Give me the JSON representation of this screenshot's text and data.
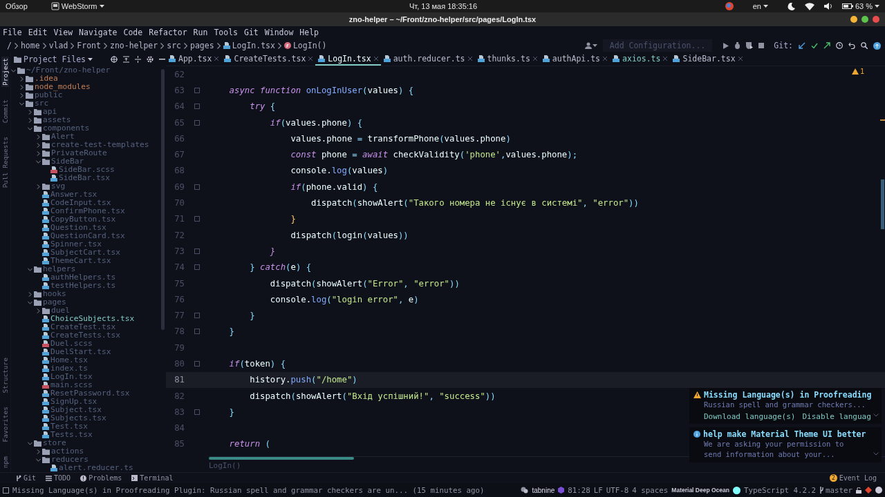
{
  "os_bar": {
    "activities": "Обзор",
    "app": "WebStorm",
    "clock": "Чт, 13 мая  18:35:16",
    "language": "en",
    "battery": "63 %"
  },
  "window": {
    "title": "zno-helper – ~/Front/zno-helper/src/pages/LogIn.tsx"
  },
  "menu": [
    "File",
    "Edit",
    "View",
    "Navigate",
    "Code",
    "Refactor",
    "Run",
    "Tools",
    "Git",
    "Window",
    "Help"
  ],
  "breadcrumbs": [
    {
      "label": "/",
      "kind": "dir"
    },
    {
      "label": "home",
      "kind": "dir"
    },
    {
      "label": "vlad",
      "kind": "dir"
    },
    {
      "label": "Front",
      "kind": "dir"
    },
    {
      "label": "zno-helper",
      "kind": "dir"
    },
    {
      "label": "src",
      "kind": "dir"
    },
    {
      "label": "pages",
      "kind": "dir"
    },
    {
      "label": "LogIn.tsx",
      "kind": "file"
    },
    {
      "label": "LogIn()",
      "kind": "function"
    }
  ],
  "toolbar": {
    "run_configuration": "Add Configuration...",
    "git_label": "Git:"
  },
  "left_strip": {
    "top": [
      {
        "label": "Project",
        "selected": true
      },
      {
        "label": "Commit",
        "selected": false
      },
      {
        "label": "Pull Requests",
        "selected": false
      }
    ],
    "bottom": [
      {
        "label": "Structure",
        "selected": false
      },
      {
        "label": "Favorites",
        "selected": false
      },
      {
        "label": "npm",
        "selected": false
      }
    ]
  },
  "project_panel": {
    "title": "Project Files"
  },
  "tabs": [
    {
      "label": "App.tsx",
      "selected": false,
      "color": "#b7bbcc"
    },
    {
      "label": "CreateTests.tsx",
      "selected": false,
      "color": "#b7bbcc"
    },
    {
      "label": "LogIn.tsx",
      "selected": true,
      "color": "#eeffff"
    },
    {
      "label": "auth.reducer.ts",
      "selected": false,
      "color": "#b7bbcc"
    },
    {
      "label": "thunks.ts",
      "selected": false,
      "color": "#b7bbcc"
    },
    {
      "label": "authApi.ts",
      "selected": false,
      "color": "#b7bbcc"
    },
    {
      "label": "axios.ts",
      "selected": false,
      "color": "#80cbc4"
    },
    {
      "label": "SideBar.tsx",
      "selected": false,
      "color": "#b7bbcc"
    }
  ],
  "tree": [
    {
      "label": "~/Front/zno-helper",
      "kind": "folder",
      "expanded": true,
      "color": "#56627f",
      "children": [
        {
          "label": ".idea",
          "kind": "folder",
          "expanded": false,
          "color": "#c17e55"
        },
        {
          "label": "node_modules",
          "kind": "folder",
          "expanded": false,
          "color": "#c17e55"
        },
        {
          "label": "public",
          "kind": "folder",
          "expanded": false,
          "color": "#56627f"
        },
        {
          "label": "src",
          "kind": "folder",
          "expanded": true,
          "color": "#56627f",
          "children": [
            {
              "label": "api",
              "kind": "folder",
              "expanded": false,
              "color": "#56627f"
            },
            {
              "label": "assets",
              "kind": "folder",
              "expanded": false,
              "color": "#56627f"
            },
            {
              "label": "components",
              "kind": "folder",
              "expanded": true,
              "color": "#56627f",
              "children": [
                {
                  "label": "Alert",
                  "kind": "folder",
                  "expanded": false,
                  "color": "#56627f"
                },
                {
                  "label": "create-test-templates",
                  "kind": "folder",
                  "expanded": false,
                  "color": "#56627f"
                },
                {
                  "label": "PrivateRoute",
                  "kind": "folder",
                  "expanded": false,
                  "color": "#56627f"
                },
                {
                  "label": "SideBar",
                  "kind": "folder",
                  "expanded": true,
                  "color": "#56627f",
                  "children": [
                    {
                      "label": "SideBar.scss",
                      "kind": "style",
                      "color": "#56627f"
                    },
                    {
                      "label": "SideBar.tsx",
                      "kind": "script",
                      "color": "#56627f"
                    }
                  ]
                },
                {
                  "label": "svg",
                  "kind": "folder",
                  "expanded": false,
                  "color": "#56627f"
                },
                {
                  "label": "Answer.tsx",
                  "kind": "script",
                  "color": "#56627f"
                },
                {
                  "label": "CodeInput.tsx",
                  "kind": "script",
                  "color": "#56627f"
                },
                {
                  "label": "ConfirmPhone.tsx",
                  "kind": "script",
                  "color": "#56627f"
                },
                {
                  "label": "CopyButton.tsx",
                  "kind": "script",
                  "color": "#56627f"
                },
                {
                  "label": "Question.tsx",
                  "kind": "script",
                  "color": "#56627f"
                },
                {
                  "label": "QuestionCard.tsx",
                  "kind": "script",
                  "color": "#56627f"
                },
                {
                  "label": "Spinner.tsx",
                  "kind": "script",
                  "color": "#56627f"
                },
                {
                  "label": "SubjectCart.tsx",
                  "kind": "script",
                  "color": "#56627f"
                },
                {
                  "label": "ThemeCart.tsx",
                  "kind": "script",
                  "color": "#56627f"
                }
              ]
            },
            {
              "label": "helpers",
              "kind": "folder",
              "expanded": true,
              "color": "#56627f",
              "children": [
                {
                  "label": "authHelpers.ts",
                  "kind": "script",
                  "color": "#56627f"
                },
                {
                  "label": "testHelpers.ts",
                  "kind": "script",
                  "color": "#56627f"
                }
              ]
            },
            {
              "label": "hooks",
              "kind": "folder",
              "expanded": false,
              "color": "#56627f"
            },
            {
              "label": "pages",
              "kind": "folder",
              "expanded": true,
              "color": "#56627f",
              "children": [
                {
                  "label": "duel",
                  "kind": "folder",
                  "expanded": false,
                  "color": "#56627f"
                },
                {
                  "label": "ChoiceSubjects.tsx",
                  "kind": "script",
                  "color": "#80cbc4"
                },
                {
                  "label": "CreateTest.tsx",
                  "kind": "script",
                  "color": "#56627f"
                },
                {
                  "label": "CreateTests.tsx",
                  "kind": "script",
                  "color": "#56627f"
                },
                {
                  "label": "Duel.scss",
                  "kind": "style",
                  "color": "#56627f"
                },
                {
                  "label": "DuelStart.tsx",
                  "kind": "script",
                  "color": "#56627f"
                },
                {
                  "label": "Home.tsx",
                  "kind": "script",
                  "color": "#56627f"
                },
                {
                  "label": "index.ts",
                  "kind": "script",
                  "color": "#56627f"
                },
                {
                  "label": "LogIn.tsx",
                  "kind": "script",
                  "color": "#56627f"
                },
                {
                  "label": "main.scss",
                  "kind": "style",
                  "color": "#56627f"
                },
                {
                  "label": "ResetPassword.tsx",
                  "kind": "script",
                  "color": "#56627f"
                },
                {
                  "label": "SignUp.tsx",
                  "kind": "script",
                  "color": "#56627f"
                },
                {
                  "label": "Subject.tsx",
                  "kind": "script",
                  "color": "#56627f"
                },
                {
                  "label": "Subjects.tsx",
                  "kind": "script",
                  "color": "#56627f"
                },
                {
                  "label": "Test.tsx",
                  "kind": "script",
                  "color": "#56627f"
                },
                {
                  "label": "Tests.tsx",
                  "kind": "script",
                  "color": "#56627f"
                }
              ]
            },
            {
              "label": "store",
              "kind": "folder",
              "expanded": true,
              "color": "#56627f",
              "children": [
                {
                  "label": "actions",
                  "kind": "folder",
                  "expanded": false,
                  "color": "#56627f"
                },
                {
                  "label": "reducers",
                  "kind": "folder",
                  "expanded": true,
                  "color": "#56627f",
                  "children": [
                    {
                      "label": "alert.reducer.ts",
                      "kind": "script",
                      "color": "#56627f"
                    }
                  ]
                }
              ]
            }
          ]
        }
      ]
    }
  ],
  "editor": {
    "problems": "1",
    "breadcrumb": "LogIn()",
    "lines": [
      {
        "num": "62",
        "fold": false,
        "current": false
      },
      {
        "num": "63",
        "fold": true,
        "current": false,
        "tokens": [
          {
            "text": "    async function ",
            "kind": "kw"
          },
          {
            "text": "onLogInUser",
            "kind": "fn"
          },
          {
            "text": "(",
            "kind": "p"
          },
          {
            "text": "values",
            "kind": "v"
          },
          {
            "text": ") {",
            "kind": "p"
          }
        ]
      },
      {
        "num": "64",
        "fold": true,
        "current": false,
        "tokens": [
          {
            "text": "        try",
            "kind": "kw"
          },
          {
            "text": " {",
            "kind": "p"
          }
        ]
      },
      {
        "num": "65",
        "fold": true,
        "current": false,
        "tokens": [
          {
            "text": "            if",
            "kind": "kw"
          },
          {
            "text": "(",
            "kind": "p"
          },
          {
            "text": "values.phone",
            "kind": "v"
          },
          {
            "text": ") {",
            "kind": "p"
          }
        ]
      },
      {
        "num": "66",
        "fold": false,
        "current": false,
        "tokens": [
          {
            "text": "                values.phone ",
            "kind": "v"
          },
          {
            "text": "= ",
            "kind": "p"
          },
          {
            "text": "transformPhone",
            "kind": "v"
          },
          {
            "text": "(",
            "kind": "p"
          },
          {
            "text": "values.phone",
            "kind": "v"
          },
          {
            "text": ")",
            "kind": "p"
          }
        ]
      },
      {
        "num": "67",
        "fold": false,
        "current": false,
        "tokens": [
          {
            "text": "                const ",
            "kind": "kw"
          },
          {
            "text": "phone ",
            "kind": "v"
          },
          {
            "text": "= ",
            "kind": "p"
          },
          {
            "text": "await ",
            "kind": "kw"
          },
          {
            "text": "checkValidity",
            "kind": "v"
          },
          {
            "text": "(",
            "kind": "p"
          },
          {
            "text": "'phone'",
            "kind": "s"
          },
          {
            "text": ",",
            "kind": "p"
          },
          {
            "text": "values.phone",
            "kind": "v"
          },
          {
            "text": ");",
            "kind": "p"
          }
        ]
      },
      {
        "num": "68",
        "fold": false,
        "current": false,
        "tokens": [
          {
            "text": "                console.",
            "kind": "v"
          },
          {
            "text": "log",
            "kind": "fn"
          },
          {
            "text": "(",
            "kind": "p"
          },
          {
            "text": "values",
            "kind": "v"
          },
          {
            "text": ")",
            "kind": "p"
          }
        ]
      },
      {
        "num": "69",
        "fold": true,
        "current": false,
        "tokens": [
          {
            "text": "                if",
            "kind": "kw"
          },
          {
            "text": "(",
            "kind": "p"
          },
          {
            "text": "phone.valid",
            "kind": "v"
          },
          {
            "text": ") {",
            "kind": "p"
          }
        ]
      },
      {
        "num": "70",
        "fold": false,
        "current": false,
        "tokens": [
          {
            "text": "                    dispatch",
            "kind": "v"
          },
          {
            "text": "(",
            "kind": "p"
          },
          {
            "text": "showAlert",
            "kind": "v"
          },
          {
            "text": "(",
            "kind": "p"
          },
          {
            "text": "\"Такого номера не існує в системі\"",
            "kind": "s"
          },
          {
            "text": ", ",
            "kind": "p"
          },
          {
            "text": "\"error\"",
            "kind": "s"
          },
          {
            "text": "))",
            "kind": "p"
          }
        ]
      },
      {
        "num": "71",
        "fold": true,
        "current": false,
        "tokens": [
          {
            "text": "                }",
            "kind": "b"
          }
        ]
      },
      {
        "num": "72",
        "fold": false,
        "current": false,
        "tokens": [
          {
            "text": "                dispatch",
            "kind": "v"
          },
          {
            "text": "(",
            "kind": "p"
          },
          {
            "text": "login",
            "kind": "v"
          },
          {
            "text": "(",
            "kind": "p"
          },
          {
            "text": "values",
            "kind": "v"
          },
          {
            "text": "))",
            "kind": "p"
          }
        ]
      },
      {
        "num": "73",
        "fold": true,
        "current": false,
        "tokens": [
          {
            "text": "            }",
            "kind": "kw"
          }
        ]
      },
      {
        "num": "74",
        "fold": true,
        "current": false,
        "tokens": [
          {
            "text": "        } ",
            "kind": "p"
          },
          {
            "text": "catch",
            "kind": "kw"
          },
          {
            "text": "(",
            "kind": "p"
          },
          {
            "text": "e",
            "kind": "v"
          },
          {
            "text": ") {",
            "kind": "p"
          }
        ]
      },
      {
        "num": "75",
        "fold": false,
        "current": false,
        "tokens": [
          {
            "text": "            dispatch",
            "kind": "v"
          },
          {
            "text": "(",
            "kind": "p"
          },
          {
            "text": "showAlert",
            "kind": "v"
          },
          {
            "text": "(",
            "kind": "p"
          },
          {
            "text": "\"Error\"",
            "kind": "s"
          },
          {
            "text": ", ",
            "kind": "p"
          },
          {
            "text": "\"error\"",
            "kind": "s"
          },
          {
            "text": "))",
            "kind": "p"
          }
        ]
      },
      {
        "num": "76",
        "fold": false,
        "current": false,
        "tokens": [
          {
            "text": "            console.",
            "kind": "v"
          },
          {
            "text": "log",
            "kind": "fn"
          },
          {
            "text": "(",
            "kind": "p"
          },
          {
            "text": "\"login error\"",
            "kind": "s"
          },
          {
            "text": ", ",
            "kind": "p"
          },
          {
            "text": "e",
            "kind": "v"
          },
          {
            "text": ")",
            "kind": "p"
          }
        ]
      },
      {
        "num": "77",
        "fold": true,
        "current": false,
        "tokens": [
          {
            "text": "        }",
            "kind": "p"
          }
        ]
      },
      {
        "num": "78",
        "fold": true,
        "current": false,
        "tokens": [
          {
            "text": "    }",
            "kind": "p"
          }
        ]
      },
      {
        "num": "79",
        "fold": false,
        "current": false
      },
      {
        "num": "80",
        "fold": true,
        "current": false,
        "tokens": [
          {
            "text": "    if",
            "kind": "kw"
          },
          {
            "text": "(",
            "kind": "p"
          },
          {
            "text": "token",
            "kind": "v"
          },
          {
            "text": ") {",
            "kind": "p"
          }
        ]
      },
      {
        "num": "81",
        "fold": false,
        "current": true,
        "tokens": [
          {
            "text": "        history.",
            "kind": "v"
          },
          {
            "text": "push",
            "kind": "fn"
          },
          {
            "text": "(",
            "kind": "p"
          },
          {
            "text": "\"/home\"",
            "kind": "s"
          },
          {
            "text": ")",
            "kind": "p"
          }
        ]
      },
      {
        "num": "82",
        "fold": false,
        "current": false,
        "tokens": [
          {
            "text": "        dispatch",
            "kind": "v"
          },
          {
            "text": "(",
            "kind": "p"
          },
          {
            "text": "showAlert",
            "kind": "v"
          },
          {
            "text": "(",
            "kind": "p"
          },
          {
            "text": "\"Вхід успішний!\"",
            "kind": "s"
          },
          {
            "text": ", ",
            "kind": "p"
          },
          {
            "text": "\"success\"",
            "kind": "s"
          },
          {
            "text": "))",
            "kind": "p"
          }
        ]
      },
      {
        "num": "83",
        "fold": true,
        "current": false,
        "tokens": [
          {
            "text": "    }",
            "kind": "p"
          }
        ]
      },
      {
        "num": "84",
        "fold": false,
        "current": false
      },
      {
        "num": "85",
        "fold": false,
        "current": false,
        "tokens": [
          {
            "text": "    return",
            "kind": "kw"
          },
          {
            "text": " (",
            "kind": "p"
          }
        ]
      }
    ]
  },
  "notifications": [
    {
      "kind": "warning",
      "title": "Missing Language(s) in Proofreading",
      "body_lines": [
        "Russian spell and grammar checkers..."
      ],
      "actions": [
        "Download language(s)",
        "Disable languag"
      ]
    },
    {
      "kind": "info",
      "title": "help make Material Theme UI better",
      "body_lines": [
        "We are asking your permission to",
        "send information about your..."
      ]
    }
  ],
  "tool_windows": [
    {
      "label": "Git",
      "kind": "git"
    },
    {
      "label": "TODO",
      "kind": "todo"
    },
    {
      "label": "Problems",
      "kind": "problems"
    },
    {
      "label": "Terminal",
      "kind": "terminal"
    }
  ],
  "event_log": {
    "label": "Event Log",
    "count": "2"
  },
  "status_bar": {
    "message": "Missing Language(s) in Proofreading Plugin: Russian spell and grammar checkers are un... (15 minutes ago)",
    "tabnine": "tabnine",
    "position": "81:28",
    "line_separator": "LF",
    "encoding": "UTF-8",
    "indent": "4 spaces",
    "theme": "Material Deep Ocean",
    "language": "TypeScript 4.2.2",
    "branch": "master"
  }
}
